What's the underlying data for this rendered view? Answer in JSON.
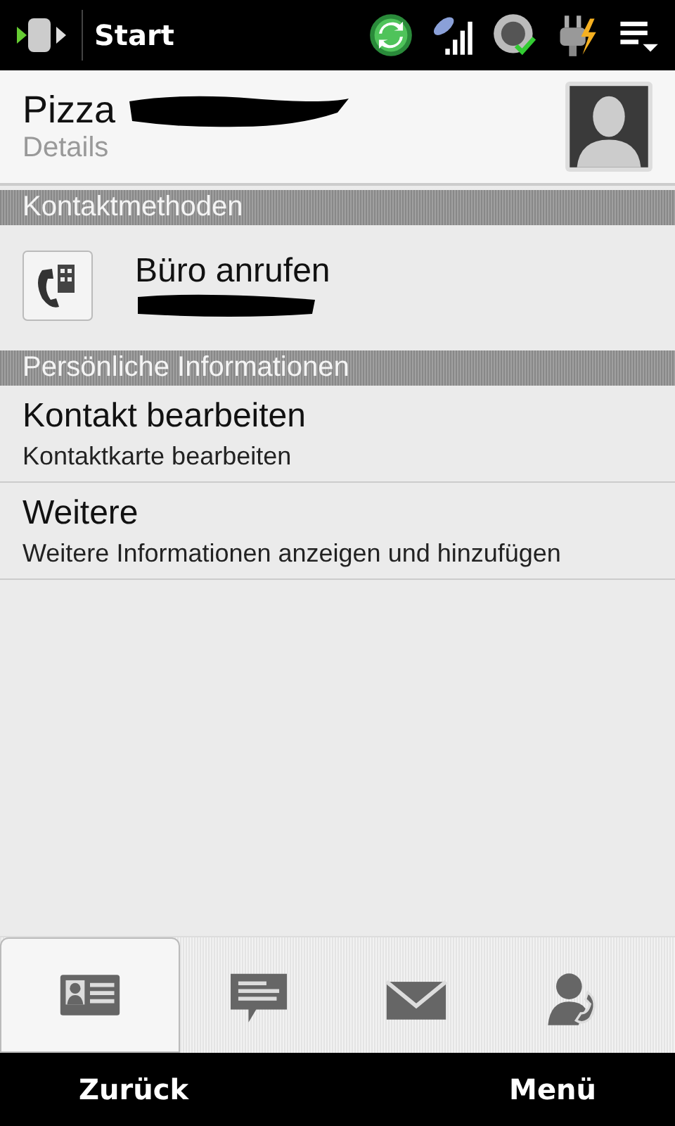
{
  "status_bar": {
    "title": "Start"
  },
  "contact": {
    "name": "Pizza",
    "subtitle": "Details"
  },
  "sections": [
    {
      "title": "Kontaktmethoden",
      "items": [
        {
          "kind": "call",
          "title": "Büro anrufen"
        }
      ]
    },
    {
      "title": "Persönliche Informationen",
      "items": [
        {
          "kind": "text",
          "title": "Kontakt bearbeiten",
          "subtitle": "Kontaktkarte bearbeiten"
        },
        {
          "kind": "text",
          "title": "Weitere",
          "subtitle": "Weitere Informationen anzeigen und hinzufügen"
        }
      ]
    }
  ],
  "tabs": [
    {
      "kind": "card",
      "selected": true
    },
    {
      "kind": "message",
      "selected": false
    },
    {
      "kind": "mail",
      "selected": false
    },
    {
      "kind": "person-phone",
      "selected": false
    }
  ],
  "softkeys": [
    "Zurück",
    "Menü"
  ]
}
